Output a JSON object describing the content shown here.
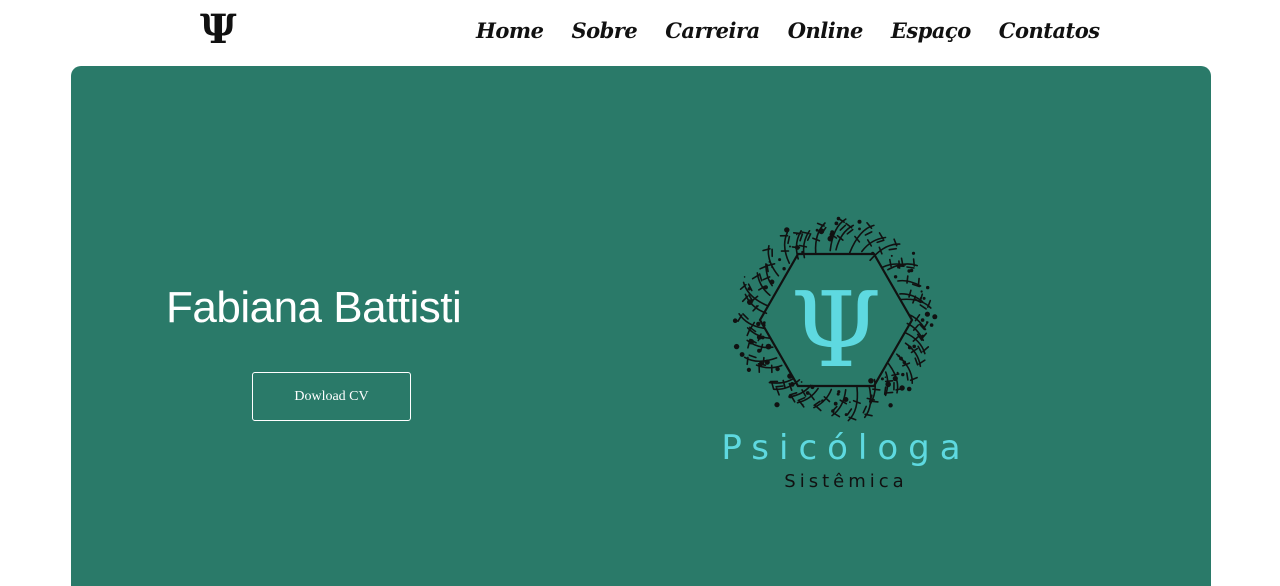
{
  "header": {
    "logo_symbol": "Ψ",
    "nav": [
      {
        "label": "Home"
      },
      {
        "label": "Sobre"
      },
      {
        "label": "Carreira"
      },
      {
        "label": "Online"
      },
      {
        "label": "Espaço"
      },
      {
        "label": "Contatos"
      }
    ]
  },
  "hero": {
    "name": "Fabiana Battisti",
    "cv_button": "Dowload CV",
    "background_color": "#2a7a69"
  },
  "brand": {
    "symbol": "Ψ",
    "title": "Psicóloga",
    "subtitle": "Sistêmica",
    "accent_color": "#5ed9e0",
    "icon": "psi-hexagon-wreath-logo"
  }
}
